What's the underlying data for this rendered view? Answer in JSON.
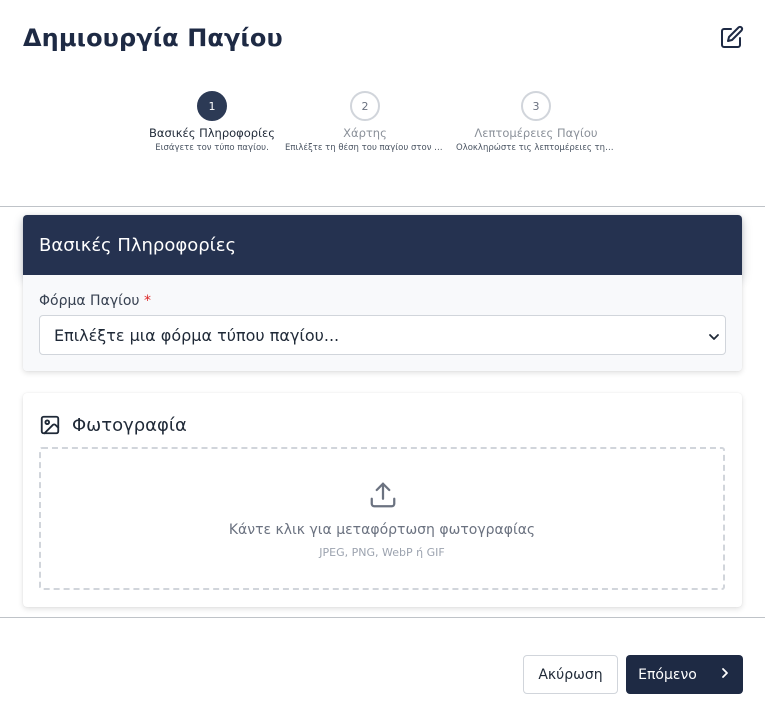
{
  "page": {
    "title": "Δημιουργία Παγίου",
    "edit_icon": "edit-icon"
  },
  "stepper": {
    "steps": [
      {
        "number": "1",
        "title": "Βασικές Πληροφορίες",
        "description": "Εισάγετε τον τύπο παγίου.",
        "state": "active"
      },
      {
        "number": "2",
        "title": "Χάρτης",
        "description": "Επιλέξτε τη θέση του παγίου στον χάρτη.",
        "state": "pending"
      },
      {
        "number": "3",
        "title": "Λεπτομέρειες Παγίου",
        "description": "Ολοκληρώστε τις λεπτομέρειες της καταχώρησης.",
        "state": "pending"
      }
    ]
  },
  "basic_info": {
    "heading": "Βασικές Πληροφορίες",
    "form_label": "Φόρμα Παγίου",
    "required_mark": "*",
    "select_value": "Επιλέξτε μια φόρμα τύπου παγίου..."
  },
  "photo": {
    "heading": "Φωτογραφία",
    "upload_text": "Κάντε κλικ για μεταφόρτωση φωτογραφίας",
    "formats": "JPEG, PNG, WebP ή GIF"
  },
  "footer": {
    "cancel_label": "Ακύρωση",
    "next_label": "Επόμενο"
  },
  "colors": {
    "primary": "#1e2a44",
    "header_card": "#253250",
    "required": "#dc2626"
  }
}
